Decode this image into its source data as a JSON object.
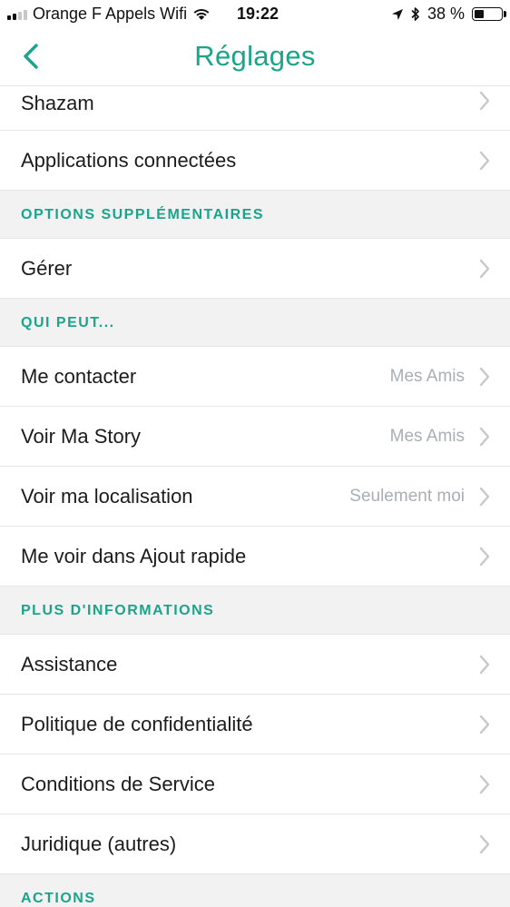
{
  "status_bar": {
    "carrier": "Orange F Appels Wifi",
    "time": "19:22",
    "battery_percent_label": "38 %",
    "battery_level": 0.38
  },
  "nav": {
    "title": "Réglages",
    "back_icon": "chevron-left-icon"
  },
  "colors": {
    "accent": "#1aa58a",
    "section_bg": "#f2f2f2",
    "value_text": "#a9afb5",
    "chevron": "#c7c7cc"
  },
  "rows_top": [
    {
      "label": "Shazam"
    },
    {
      "label": "Applications connectées"
    }
  ],
  "sections": {
    "options": {
      "title": "OPTIONS SUPPLÉMENTAIRES",
      "items": [
        {
          "label": "Gérer"
        }
      ]
    },
    "qui_peut": {
      "title": "QUI PEUT...",
      "items": [
        {
          "label": "Me contacter",
          "value": "Mes Amis"
        },
        {
          "label": "Voir Ma Story",
          "value": "Mes Amis"
        },
        {
          "label": "Voir ma localisation",
          "value": "Seulement moi"
        },
        {
          "label": "Me voir dans Ajout rapide"
        }
      ]
    },
    "plus_info": {
      "title": "PLUS D'INFORMATIONS",
      "items": [
        {
          "label": "Assistance"
        },
        {
          "label": "Politique de confidentialité"
        },
        {
          "label": "Conditions de Service"
        },
        {
          "label": "Juridique (autres)"
        }
      ]
    },
    "actions": {
      "title": "ACTIONS"
    }
  }
}
